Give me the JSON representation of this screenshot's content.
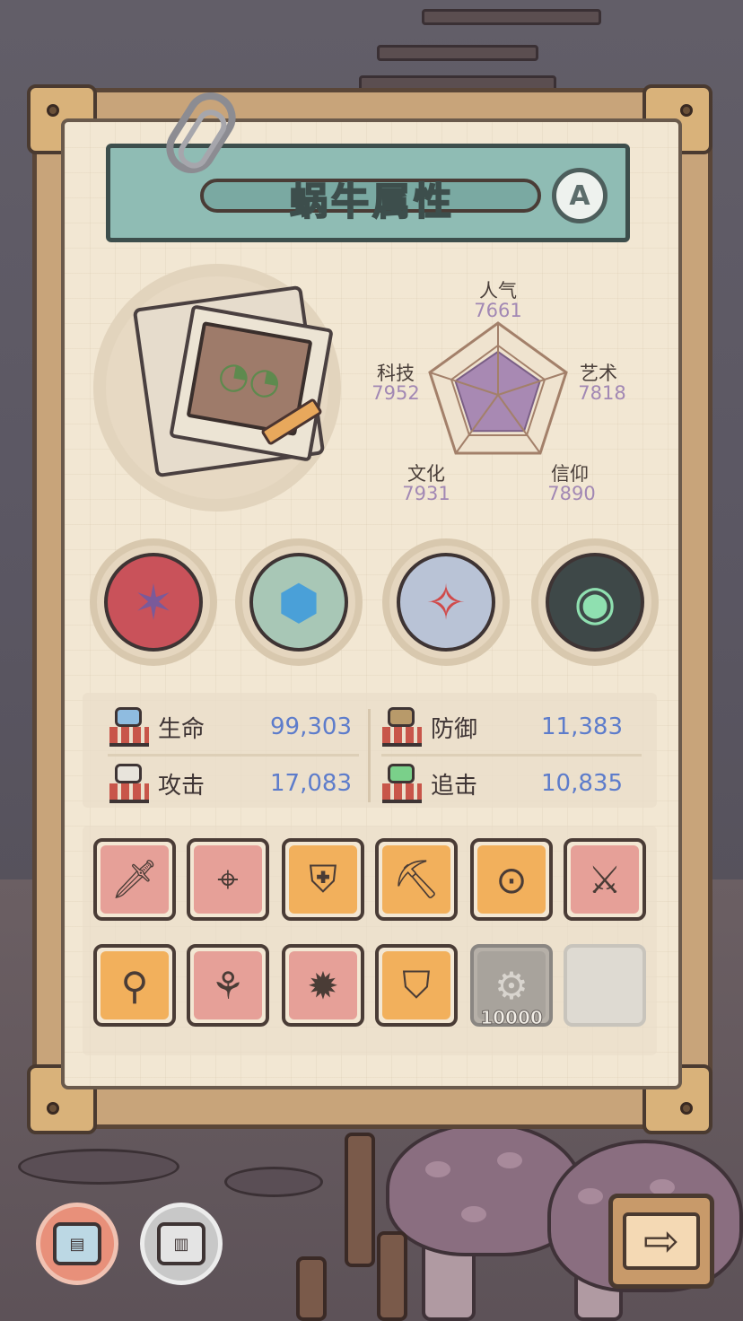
{
  "header": {
    "title": "蜗牛属性",
    "grade": "A"
  },
  "radar": {
    "stats": [
      {
        "label": "人气",
        "value": "7661"
      },
      {
        "label": "艺术",
        "value": "7818"
      },
      {
        "label": "信仰",
        "value": "7890"
      },
      {
        "label": "文化",
        "value": "7931"
      },
      {
        "label": "科技",
        "value": "7952"
      }
    ],
    "fill_color": "#a889b3"
  },
  "relics": [
    {
      "icon": "thorny-vine-relic-icon"
    },
    {
      "icon": "crystal-stone-relic-icon"
    },
    {
      "icon": "compass-relic-icon"
    },
    {
      "icon": "green-flame-portal-relic-icon"
    }
  ],
  "combat": {
    "hp": {
      "label": "生命",
      "value": "99,303"
    },
    "def": {
      "label": "防御",
      "value": "11,383"
    },
    "atk": {
      "label": "攻击",
      "value": "17,083"
    },
    "pursuit": {
      "label": "追击",
      "value": "10,835"
    },
    "value_color": "#5d7ccb"
  },
  "equipment": {
    "row1": [
      {
        "icon": "dagger-icon",
        "rarity": "red"
      },
      {
        "icon": "blaster-gun-icon",
        "rarity": "red"
      },
      {
        "icon": "armor-vest-icon",
        "rarity": "orange"
      },
      {
        "icon": "scythe-pick-icon",
        "rarity": "orange"
      },
      {
        "icon": "goggles-icon",
        "rarity": "orange"
      },
      {
        "icon": "crossed-swords-icon",
        "rarity": "red"
      }
    ],
    "row2": [
      {
        "icon": "short-sword-icon",
        "rarity": "orange"
      },
      {
        "icon": "slingshot-icon",
        "rarity": "red"
      },
      {
        "icon": "spiked-mace-icon",
        "rarity": "red"
      },
      {
        "icon": "tank-top-icon",
        "rarity": "orange"
      },
      {
        "icon": "gear-icon",
        "rarity": "locked",
        "count": "10000"
      },
      {
        "icon": "",
        "rarity": "empty"
      }
    ]
  }
}
